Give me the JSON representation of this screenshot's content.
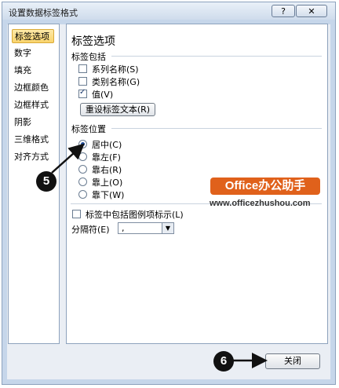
{
  "window": {
    "title": "设置数据标签格式",
    "help": "?",
    "close": "✕"
  },
  "nav": [
    "标签选项",
    "数字",
    "填充",
    "边框颜色",
    "边框样式",
    "阴影",
    "三维格式",
    "对齐方式"
  ],
  "panel": {
    "title": "标签选项",
    "contains_group": "标签包括",
    "contains": [
      {
        "label": "系列名称(S)",
        "checked": false
      },
      {
        "label": "类别名称(G)",
        "checked": false
      },
      {
        "label": "值(V)",
        "checked": true
      }
    ],
    "reset_button": "重设标签文本(R)",
    "position_group": "标签位置",
    "positions": [
      {
        "label": "居中(C)",
        "selected": true
      },
      {
        "label": "靠左(F)",
        "selected": false
      },
      {
        "label": "靠右(R)",
        "selected": false
      },
      {
        "label": "靠上(O)",
        "selected": false
      },
      {
        "label": "靠下(W)",
        "selected": false
      }
    ],
    "legend_key_label": "标签中包括图例项标示(L)",
    "legend_key_checked": false,
    "separator_label": "分隔符(E)",
    "separator_value": ","
  },
  "footer": {
    "close_button": "关闭"
  },
  "callouts": [
    "5",
    "6"
  ],
  "watermark": {
    "brand": "Office办公助手",
    "url": "www.officezhushou.com"
  },
  "colors": {
    "accent": "#e0611b",
    "selected_nav": "#f9d46c"
  }
}
